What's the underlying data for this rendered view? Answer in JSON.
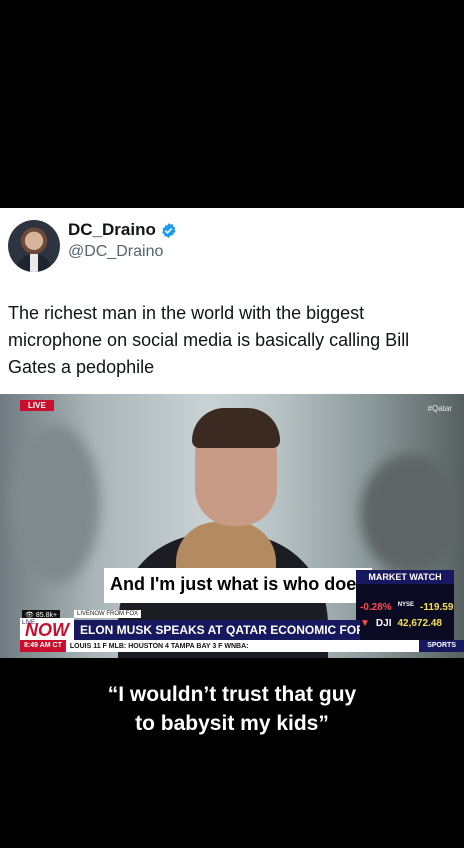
{
  "tweet": {
    "display_name": "DC_Draino",
    "handle": "@DC_Draino",
    "text": "The richest man in the world with the biggest microphone on social media is basically calling Bill Gates a pedophile"
  },
  "video": {
    "live_tag": "LIVE",
    "hashtag": "#Qatar",
    "caption": "And I'm just what is who does",
    "market_watch": {
      "title": "MARKET WATCH",
      "row1_pct": "-0.28%",
      "row1_label": "NYSE",
      "row1_value": "-119.59",
      "row2_label": "DJI",
      "row2_value": "42,672.48"
    },
    "views": "85.8k+",
    "live_now_label": "LIVENOW FROM FOX",
    "now_label": "NOW",
    "now_live_label": "LIVE",
    "headline": "ELON MUSK SPEAKS AT QATAR ECONOMIC FORUM",
    "ticker_time": "8:49 AM CT",
    "ticker_text": "LOUIS 11 F   MLB: HOUSTON 4 TAMPA BAY 3 F   WNBA:",
    "ticker_sports": "SPORTS"
  },
  "subtitle": {
    "line1": "“I wouldn’t trust that guy",
    "line2": "to babysit my kids”"
  },
  "colors": {
    "accent_red": "#c8102e",
    "fox_navy": "#17185e",
    "verified_blue": "#1d9bf0"
  }
}
